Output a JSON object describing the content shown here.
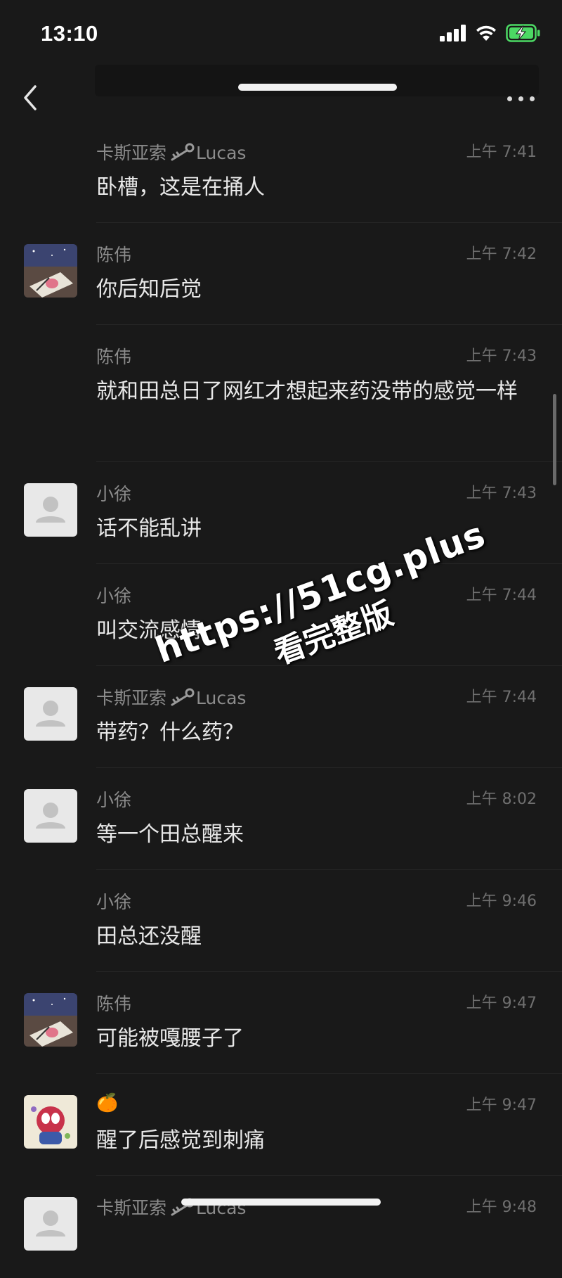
{
  "status_bar": {
    "time": "13:10"
  },
  "header": {
    "title": "",
    "more": "•••"
  },
  "messages": [
    {
      "name": "卡斯亚索",
      "name_suffix": "Lucas",
      "has_key": true,
      "time": "上午 7:41",
      "text": "卧槽，这是在捅人",
      "avatar": "none"
    },
    {
      "name": "陈伟",
      "name_suffix": "",
      "has_key": false,
      "time": "上午 7:42",
      "text": "你后知后觉",
      "avatar": "photo"
    },
    {
      "name": "陈伟",
      "name_suffix": "",
      "has_key": false,
      "time": "上午 7:43",
      "text": "就和田总日了网红才想起来药没带的感觉一样",
      "avatar": "none"
    },
    {
      "name": "小徐",
      "name_suffix": "",
      "has_key": false,
      "time": "上午 7:43",
      "text": "话不能乱讲",
      "avatar": "default"
    },
    {
      "name": "小徐",
      "name_suffix": "",
      "has_key": false,
      "time": "上午 7:44",
      "text": "叫交流感情",
      "avatar": "none"
    },
    {
      "name": "卡斯亚索",
      "name_suffix": "Lucas",
      "has_key": true,
      "time": "上午 7:44",
      "text": "带药？什么药？",
      "avatar": "default"
    },
    {
      "name": "小徐",
      "name_suffix": "",
      "has_key": false,
      "time": "上午 8:02",
      "text": "等一个田总醒来",
      "avatar": "default"
    },
    {
      "name": "小徐",
      "name_suffix": "",
      "has_key": false,
      "time": "上午 9:46",
      "text": "田总还没醒",
      "avatar": "none"
    },
    {
      "name": "陈伟",
      "name_suffix": "",
      "has_key": false,
      "time": "上午 9:47",
      "text": "可能被嘎腰子了",
      "avatar": "photo"
    },
    {
      "name": "🍊",
      "name_suffix": "",
      "has_key": false,
      "time": "上午 9:47",
      "text": "醒了后感觉到刺痛",
      "avatar": "cartoon"
    },
    {
      "name": "卡斯亚索",
      "name_suffix": "Lucas",
      "has_key": true,
      "time": "上午 9:48",
      "text": "",
      "avatar": "default"
    }
  ],
  "watermark": {
    "url": "https://51cg.plus",
    "subtitle": "看完整版"
  },
  "colors": {
    "background": "#191919",
    "text": "#e8e8e8",
    "name": "#8c8c8c",
    "time": "#6f6f6f",
    "battery": "#4cd964"
  },
  "icons": {
    "back": "chevron-left-icon",
    "more": "more-dots-icon",
    "avatar_default": "person-icon",
    "key": "key-icon"
  }
}
